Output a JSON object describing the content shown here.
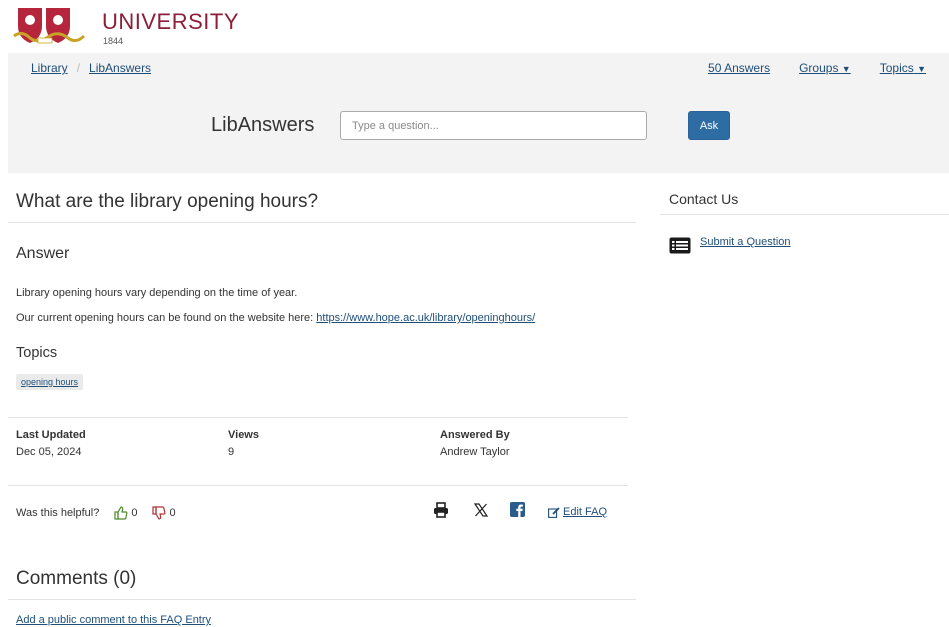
{
  "header": {
    "university_name": "UNIVERSITY",
    "founded_year": "1844",
    "crest_colors": {
      "red": "#b5253b",
      "white": "#ffffff",
      "gold": "#c9a227"
    }
  },
  "breadcrumb": [
    {
      "label": "Library"
    },
    {
      "label": "LibAnswers"
    }
  ],
  "top_nav": {
    "answers_link": "50 Answers",
    "groups": "Groups",
    "topics": "Topics"
  },
  "search": {
    "title": "LibAnswers",
    "placeholder": "Type a question...",
    "ask_button": "Ask"
  },
  "faq": {
    "question": "What are the library opening hours?",
    "answer_heading": "Answer",
    "answer_line_1": "Library opening hours vary depending on the time of year.",
    "answer_line_2_prefix": "Our current opening hours can be found on the website here:",
    "answer_link": "https://www.hope.ac.uk/library/openinghours/",
    "topics_heading": "Topics",
    "topic_tags": [
      "opening hours"
    ]
  },
  "meta": {
    "last_updated_label": "Last Updated",
    "last_updated_value": "Dec 05, 2024",
    "views_label": "Views",
    "views_value": "9",
    "answered_by_label": "Answered By",
    "answered_by_value": "Andrew Taylor"
  },
  "feedback": {
    "question": "Was this helpful?",
    "thumbs_up_count": "0",
    "thumbs_down_count": "0",
    "share_icons": [
      "print-icon",
      "x-icon",
      "facebook-icon"
    ],
    "edit_label": "Edit FAQ"
  },
  "comments": {
    "heading": "Comments (0)",
    "add_link": "Add a public comment to this FAQ Entry"
  },
  "sidebar": {
    "heading": "Contact Us",
    "submit_link": "Submit a Question"
  },
  "colors": {
    "brand": "#8b1f3a",
    "link": "#1f4e79",
    "band_bg": "#f3f3f3",
    "ask_button": "#2e6da4"
  }
}
